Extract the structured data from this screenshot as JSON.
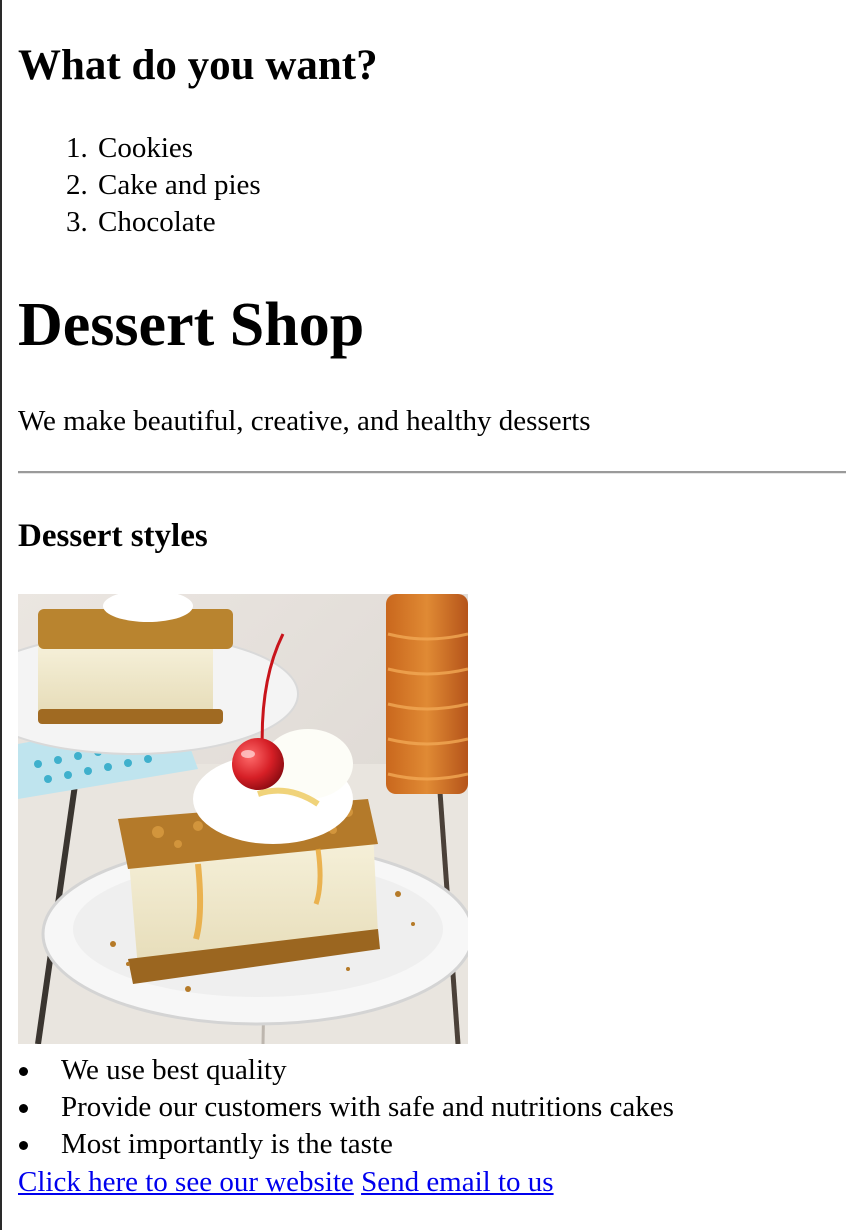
{
  "question_heading": "What do you want?",
  "choices": [
    {
      "number": "1.",
      "label": "Cookies"
    },
    {
      "number": "2.",
      "label": "Cake and pies"
    },
    {
      "number": "3.",
      "label": "Chocolate"
    }
  ],
  "shop": {
    "title": "Dessert Shop",
    "tagline": "We make beautiful, creative, and healthy desserts"
  },
  "styles_heading": "Dessert styles",
  "image": {
    "subject": "cheesecake-dessert-with-cherry-and-honey-jar"
  },
  "features": [
    "We use best quality",
    "Provide our customers with safe and nutritions cakes",
    "Most importantly is the taste"
  ],
  "links": {
    "website": "Click here to see our website",
    "email": "Send email to us"
  },
  "colors": {
    "link": "#0000ee",
    "text": "#000000",
    "background": "#ffffff"
  }
}
